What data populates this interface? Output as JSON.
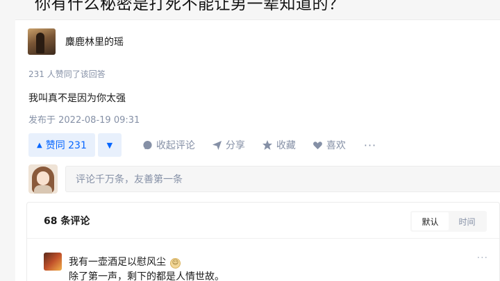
{
  "question": {
    "title": "你有什么秘密是打死不能让男一辈知道的？"
  },
  "answer": {
    "author_name": "麋鹿林里的瑶",
    "vote_meta": "231 人赞同了该回答",
    "content": "我叫真不是因为你太强",
    "publish_time": "发布于 2022-08-19 09:31"
  },
  "actions": {
    "vote_up_label": "赞同 231",
    "vote_up_icon": "▲",
    "vote_down_icon": "▼",
    "comment_label": "收起评论",
    "share_label": "分享",
    "favorite_label": "收藏",
    "like_label": "喜欢",
    "more_label": "···"
  },
  "comment_input": {
    "placeholder": "评论千万条，友善第一条"
  },
  "comments": {
    "count_label": "68 条评论",
    "sort_options": [
      "默认",
      "时间"
    ],
    "items": [
      {
        "author": "我有一壶酒足以慰风尘",
        "badge_icon": "☺",
        "text": "除了第一声，剩下的都是人情世故。",
        "more_label": "···"
      }
    ]
  },
  "colors": {
    "accent": "#0566ff",
    "accent_bg": "#e8f0fc",
    "muted": "#8590a6"
  }
}
